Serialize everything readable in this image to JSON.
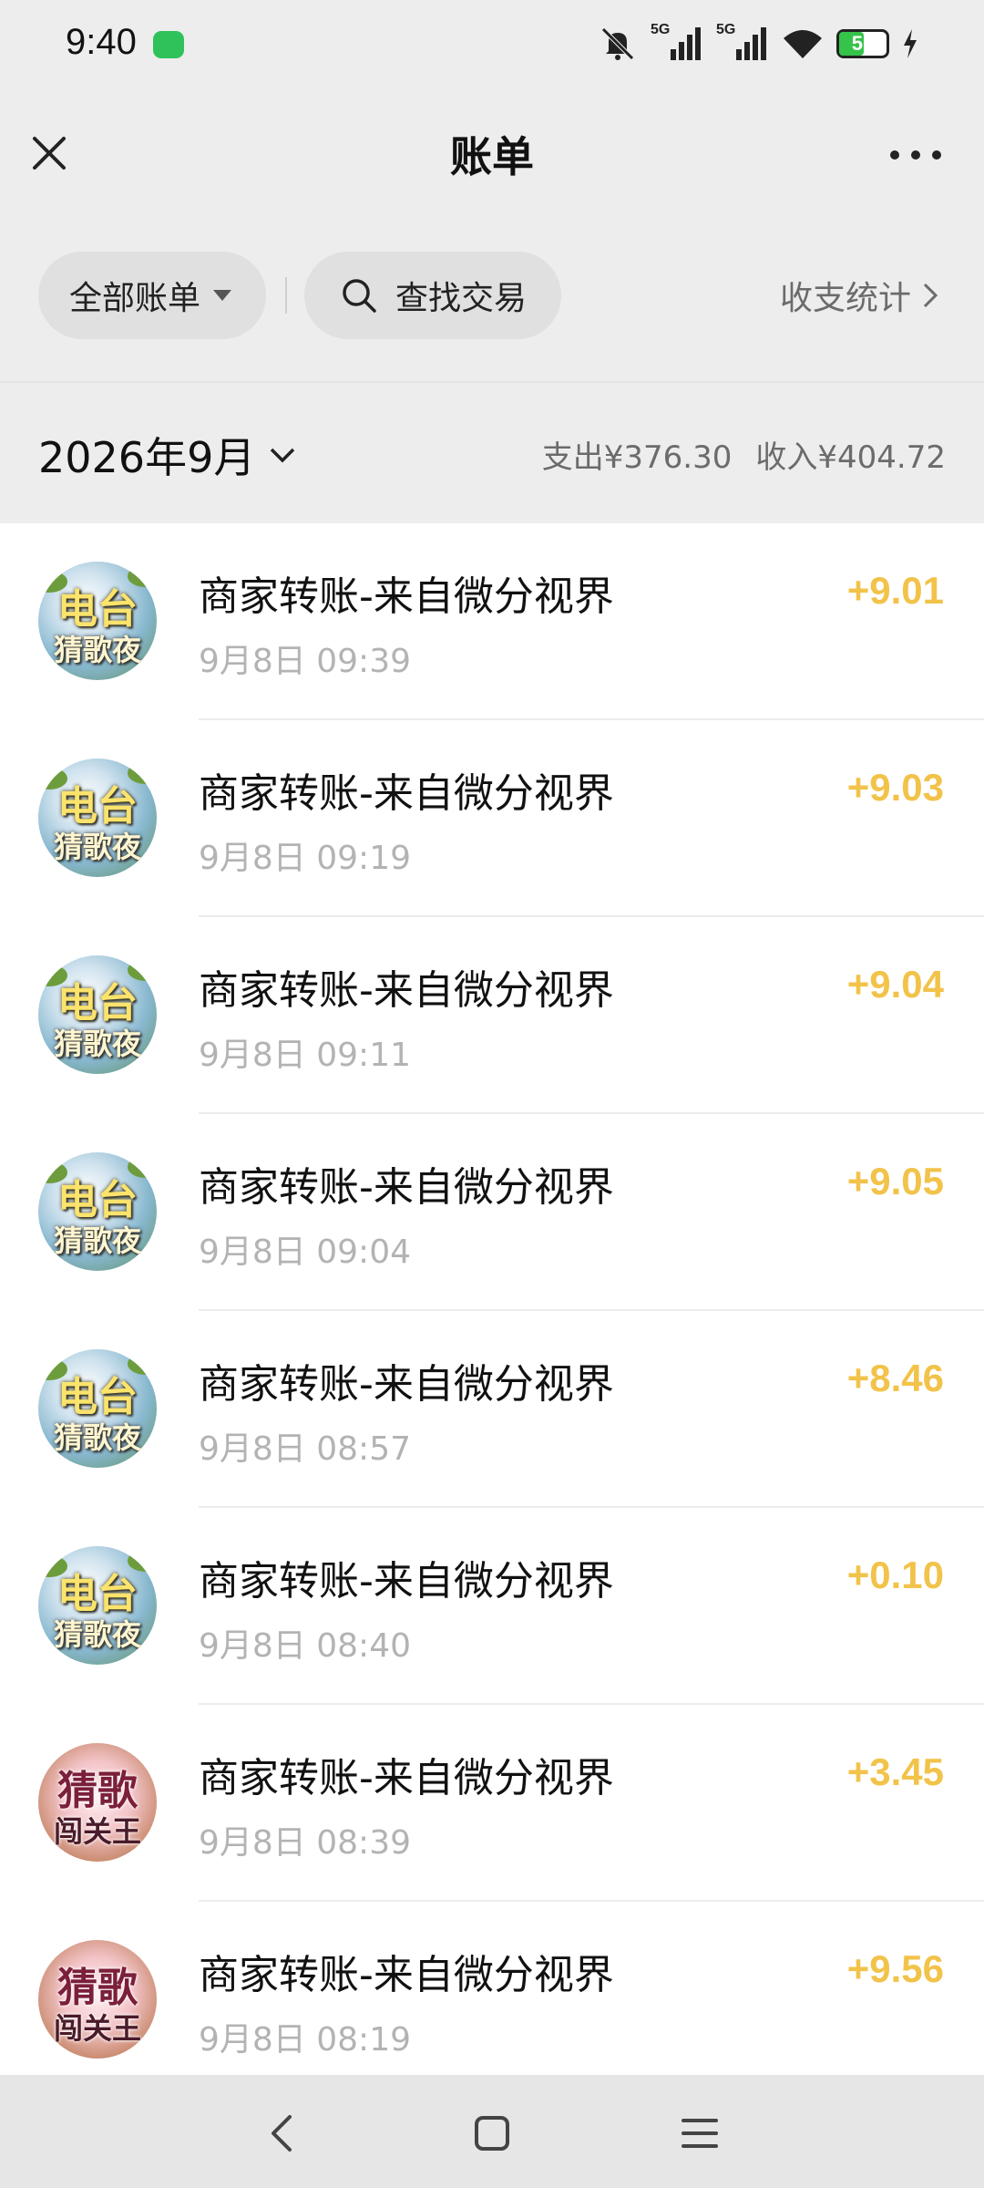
{
  "status_bar": {
    "time": "9:40",
    "signal_label_1": "5G",
    "signal_label_2": "5G",
    "battery_level": "51",
    "battery_fraction": 0.51,
    "icons": [
      "chat-app-icon",
      "mute-icon",
      "signal-icon",
      "wifi-icon",
      "battery-icon",
      "charging-icon"
    ]
  },
  "header": {
    "title": "账单",
    "close_icon": "close-icon",
    "more_icon": "more-icon"
  },
  "filters": {
    "all_bills_label": "全部账单",
    "search_label": "查找交易",
    "stats_label": "收支统计"
  },
  "month": {
    "label": "2026年9月",
    "expense": "支出¥376.30",
    "income": "收入¥404.72"
  },
  "colors": {
    "amount": "#f2c34a",
    "background": "#ededed",
    "list_background": "#ffffff"
  },
  "transactions": [
    {
      "avatar_top": "电台",
      "avatar_bottom": "猜歌夜",
      "title": "商家转账-来自微分视界",
      "time": "9月8日 09:39",
      "amount": "+9.01"
    },
    {
      "avatar_top": "电台",
      "avatar_bottom": "猜歌夜",
      "title": "商家转账-来自微分视界",
      "time": "9月8日 09:19",
      "amount": "+9.03"
    },
    {
      "avatar_top": "电台",
      "avatar_bottom": "猜歌夜",
      "title": "商家转账-来自微分视界",
      "time": "9月8日 09:11",
      "amount": "+9.04"
    },
    {
      "avatar_top": "电台",
      "avatar_bottom": "猜歌夜",
      "title": "商家转账-来自微分视界",
      "time": "9月8日 09:04",
      "amount": "+9.05"
    },
    {
      "avatar_top": "电台",
      "avatar_bottom": "猜歌夜",
      "title": "商家转账-来自微分视界",
      "time": "9月8日 08:57",
      "amount": "+8.46"
    },
    {
      "avatar_top": "电台",
      "avatar_bottom": "猜歌夜",
      "title": "商家转账-来自微分视界",
      "time": "9月8日 08:40",
      "amount": "+0.10"
    },
    {
      "avatar_top": "猜歌",
      "avatar_bottom": "闯关王",
      "title": "商家转账-来自微分视界",
      "time": "9月8日 08:39",
      "amount": "+3.45"
    },
    {
      "avatar_top": "猜歌",
      "avatar_bottom": "闯关王",
      "title": "商家转账-来自微分视界",
      "time": "9月8日 08:19",
      "amount": "+9.56"
    }
  ],
  "nav": {
    "icons": [
      "back-icon",
      "home-icon",
      "menu-icon"
    ]
  }
}
